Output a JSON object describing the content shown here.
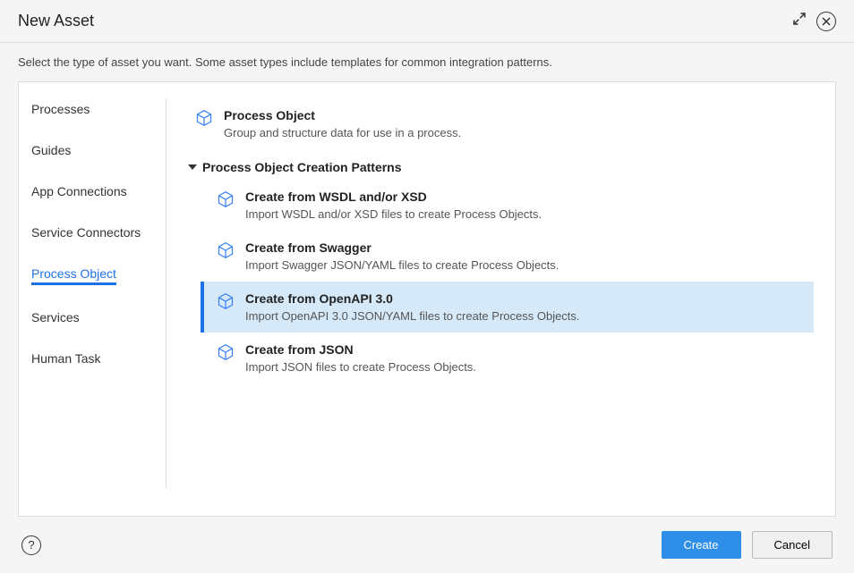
{
  "dialog": {
    "title": "New Asset",
    "subtitle": "Select the type of asset you want. Some asset types include templates for common integration patterns."
  },
  "sidebar": {
    "items": [
      {
        "label": "Processes",
        "active": false
      },
      {
        "label": "Guides",
        "active": false
      },
      {
        "label": "App Connections",
        "active": false
      },
      {
        "label": "Service Connectors",
        "active": false
      },
      {
        "label": "Process Object",
        "active": true
      },
      {
        "label": "Services",
        "active": false
      },
      {
        "label": "Human Task",
        "active": false
      }
    ]
  },
  "main": {
    "primary_option": {
      "title": "Process Object",
      "desc": "Group and structure data for use in a process."
    },
    "section_header": "Process Object Creation Patterns",
    "options": [
      {
        "title": "Create from WSDL and/or XSD",
        "desc": "Import WSDL and/or XSD files to create Process Objects.",
        "selected": false
      },
      {
        "title": "Create from Swagger",
        "desc": "Import Swagger JSON/YAML files to create Process Objects.",
        "selected": false
      },
      {
        "title": "Create from OpenAPI 3.0",
        "desc": "Import OpenAPI 3.0 JSON/YAML files to create Process Objects.",
        "selected": true
      },
      {
        "title": "Create from JSON",
        "desc": "Import JSON files to create Process Objects.",
        "selected": false
      }
    ]
  },
  "footer": {
    "create_label": "Create",
    "cancel_label": "Cancel"
  },
  "icons": {
    "cube_color": "#3b82f6"
  }
}
